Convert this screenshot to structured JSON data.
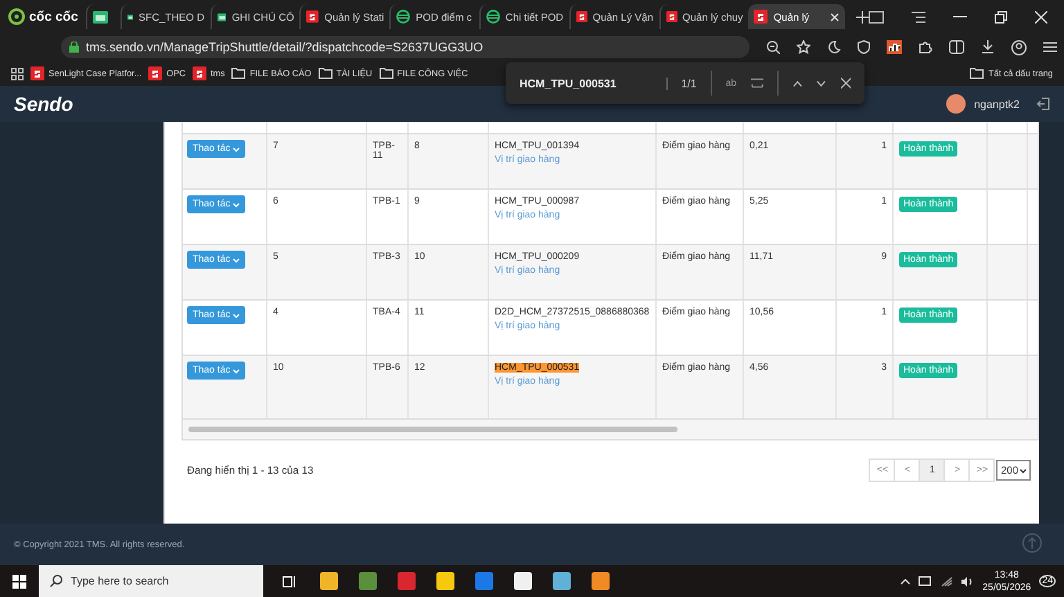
{
  "browser": {
    "brand": "cốc cốc",
    "tabs": [
      {
        "kind": "sheet",
        "selected": false
      },
      {
        "kind": "sheet",
        "label": "SFC_THEO D",
        "selected": false
      },
      {
        "kind": "sheet",
        "label": "GHI CHÚ CÔ",
        "selected": false
      },
      {
        "kind": "sendo",
        "label": "Quản lý Stati",
        "selected": false
      },
      {
        "kind": "pod",
        "label": "POD điểm c",
        "selected": false
      },
      {
        "kind": "pod",
        "label": "Chi tiết POD",
        "selected": false
      },
      {
        "kind": "sendo",
        "label": "Quản Lý Vận",
        "selected": false
      },
      {
        "kind": "sendo",
        "label": "Quản lý chuy",
        "selected": false
      },
      {
        "kind": "sendo",
        "label": "Quản lý",
        "selected": true
      }
    ],
    "url": "tms.sendo.vn/ManageTripShuttle/detail/?dispatchcode=S2637UGG3UO",
    "bookmarks": [
      {
        "kind": "sendo",
        "label": "SenLight Case Platfor..."
      },
      {
        "kind": "sendo",
        "label": "OPC"
      },
      {
        "kind": "sendo",
        "label": "tms"
      },
      {
        "kind": "folder",
        "label": "FILE BÁO CÁO"
      },
      {
        "kind": "folder",
        "label": "TÀI LIỆU"
      },
      {
        "kind": "folder",
        "label": "FILE CÔNG VIỆC"
      }
    ],
    "all_bookmarks": "Tất cả dấu trang"
  },
  "find_bar": {
    "query": "HCM_TPU_000531",
    "count": "1/1",
    "option_1": "ab"
  },
  "app_header": {
    "brand": "Sendo",
    "user": "nganptk2"
  },
  "table": {
    "rows": [
      {
        "action": "Thao tác",
        "column_2": "7",
        "column_3": "TPB-11",
        "column_4": "8",
        "code": "HCM_TPU_001394",
        "highlighted": false,
        "link": "Vị trí giao hàng",
        "type": "Điểm giao hàng",
        "column_7": "0,21",
        "column_8": "1",
        "status": "Hoàn thành"
      },
      {
        "action": "Thao tác",
        "column_2": "6",
        "column_3": "TPB-1",
        "column_4": "9",
        "code": "HCM_TPU_000987",
        "highlighted": false,
        "link": "Vị trí giao hàng",
        "type": "Điểm giao hàng",
        "column_7": "5,25",
        "column_8": "1",
        "status": "Hoàn thành"
      },
      {
        "action": "Thao tác",
        "column_2": "5",
        "column_3": "TPB-3",
        "column_4": "10",
        "code": "HCM_TPU_000209",
        "highlighted": false,
        "link": "Vị trí giao hàng",
        "type": "Điểm giao hàng",
        "column_7": "11,71",
        "column_8": "9",
        "status": "Hoàn thành"
      },
      {
        "action": "Thao tác",
        "column_2": "4",
        "column_3": "TBA-4",
        "column_4": "11",
        "code": "D2D_HCM_27372515_0886880368",
        "highlighted": false,
        "link": "Vị trí giao hàng",
        "type": "Điểm giao hàng",
        "column_7": "10,56",
        "column_8": "1",
        "status": "Hoàn thành"
      },
      {
        "action": "Thao tác",
        "column_2": "10",
        "column_3": "TPB-6",
        "column_4": "12",
        "code": "HCM_TPU_000531",
        "highlighted": true,
        "link": "Vị trí giao hàng",
        "type": "Điểm giao hàng",
        "column_7": "4,56",
        "column_8": "3",
        "status": "Hoàn thành"
      }
    ],
    "summary": "Đang hiển thị 1 - 13 của 13",
    "pages": [
      {
        "label": "<<",
        "selected": false
      },
      {
        "label": "<",
        "selected": false
      },
      {
        "label": "1",
        "selected": true
      },
      {
        "label": ">",
        "selected": false
      },
      {
        "label": ">>",
        "selected": false
      }
    ],
    "page_size": "200"
  },
  "footer": {
    "copyright": "© Copyright 2021 TMS. All rights reserved."
  },
  "taskbar": {
    "search_placeholder": "Type here to search",
    "time": "13:48",
    "date": "25/05/2026",
    "notifications": "24"
  }
}
